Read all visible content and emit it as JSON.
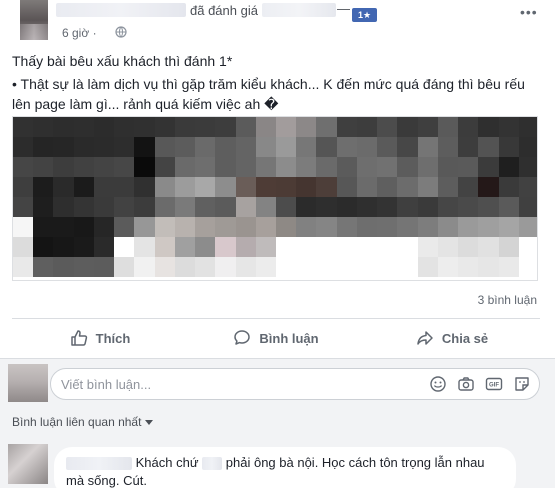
{
  "header": {
    "reviewed_text": "đã đánh giá",
    "dash": "—",
    "rating_badge": "1★",
    "time": "6 giờ",
    "time_sep": "·",
    "more_icon": "more-horizontal-icon"
  },
  "post": {
    "line1": "Thấy bài bêu xấu khách thì đánh 1*",
    "line2": "• Thật sự là làm dịch vụ thì gặp trăm kiểu khách... K đến mức quá đáng thì bêu rếu lên page làm gì... rảnh quá kiếm việc ah �"
  },
  "stats": {
    "comments_count": "3 bình luận"
  },
  "actions": {
    "like": "Thích",
    "comment": "Bình luận",
    "share": "Chia sẻ"
  },
  "comment_box": {
    "placeholder": "Viết bình luận...",
    "icons": [
      "emoji-icon",
      "camera-icon",
      "gif-icon",
      "sticker-icon"
    ]
  },
  "sort": {
    "label": "Bình luận liên quan nhất"
  },
  "comments": [
    {
      "part1": "Khách chứ",
      "part2": "phải ông bà nội. Học cách tôn trọng lẫn nhau mà sống. Cút."
    }
  ],
  "colors": {
    "accent": "#4267b2",
    "text": "#1d2129",
    "muted": "#606770",
    "background_comments": "#f2f3f5"
  }
}
